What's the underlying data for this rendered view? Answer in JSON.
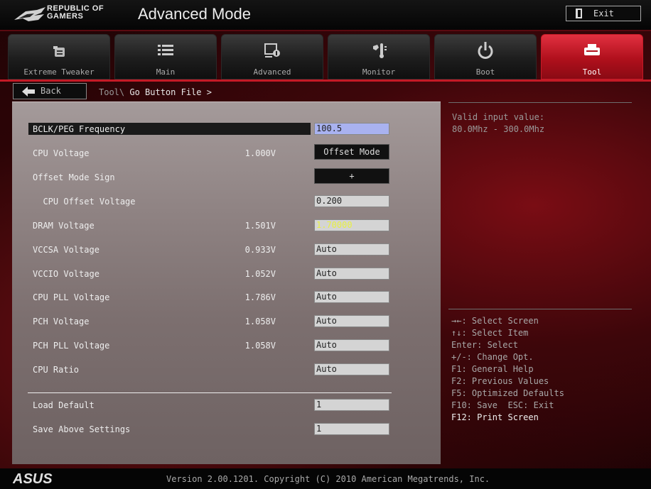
{
  "header": {
    "brand_line1": "REPUBLIC OF",
    "brand_line2": "GAMERS",
    "title": "Advanced Mode",
    "exit_label": "Exit"
  },
  "tabs": [
    {
      "label": "Extreme Tweaker",
      "icon": "tweaker-icon",
      "active": false
    },
    {
      "label": "Main",
      "icon": "list-icon",
      "active": false
    },
    {
      "label": "Advanced",
      "icon": "advanced-icon",
      "active": false
    },
    {
      "label": "Monitor",
      "icon": "monitor-icon",
      "active": false
    },
    {
      "label": "Boot",
      "icon": "power-icon",
      "active": false
    },
    {
      "label": "Tool",
      "icon": "tool-icon",
      "active": true
    }
  ],
  "breadcrumb": {
    "back_label": "Back",
    "path": "Tool\\",
    "current": "Go Button File >"
  },
  "settings": [
    {
      "label": "BCLK/PEG Frequency",
      "current": "",
      "value": "100.5"
    },
    {
      "label": "CPU Voltage",
      "current": "1.000V",
      "value": "Offset Mode"
    },
    {
      "label": "Offset Mode Sign",
      "current": "",
      "value": "+"
    },
    {
      "label": "  CPU Offset Voltage",
      "current": "",
      "value": "0.200"
    },
    {
      "label": "DRAM Voltage",
      "current": "1.501V",
      "value": "1.70000"
    },
    {
      "label": "VCCSA Voltage",
      "current": "0.933V",
      "value": "Auto"
    },
    {
      "label": "VCCIO Voltage",
      "current": "1.052V",
      "value": "Auto"
    },
    {
      "label": "CPU PLL Voltage",
      "current": "1.786V",
      "value": "Auto"
    },
    {
      "label": "PCH Voltage",
      "current": "1.058V",
      "value": "Auto"
    },
    {
      "label": "PCH PLL Voltage",
      "current": "1.058V",
      "value": "Auto"
    },
    {
      "label": "CPU Ratio",
      "current": "",
      "value": "Auto"
    },
    {
      "label": "Load Default",
      "current": "",
      "value": "1"
    },
    {
      "label": "Save Above Settings",
      "current": "",
      "value": "1"
    }
  ],
  "help": {
    "line1": "Valid input value:",
    "line2": "80.0Mhz - 300.0Mhz"
  },
  "keys": [
    "→←: Select Screen",
    "↑↓: Select Item",
    "Enter: Select",
    "+/-: Change Opt.",
    "F1: General Help",
    "F2: Previous Values",
    "F5: Optimized Defaults",
    "F10: Save  ESC: Exit",
    "F12: Print Screen"
  ],
  "footer": {
    "brand": "ASUS",
    "version": "Version 2.00.1201. Copyright (C) 2010 American Megatrends, Inc."
  },
  "colors": {
    "accent": "#c41a26",
    "selected_field": "#a9b2f0",
    "highlight_value": "#e8f040"
  }
}
